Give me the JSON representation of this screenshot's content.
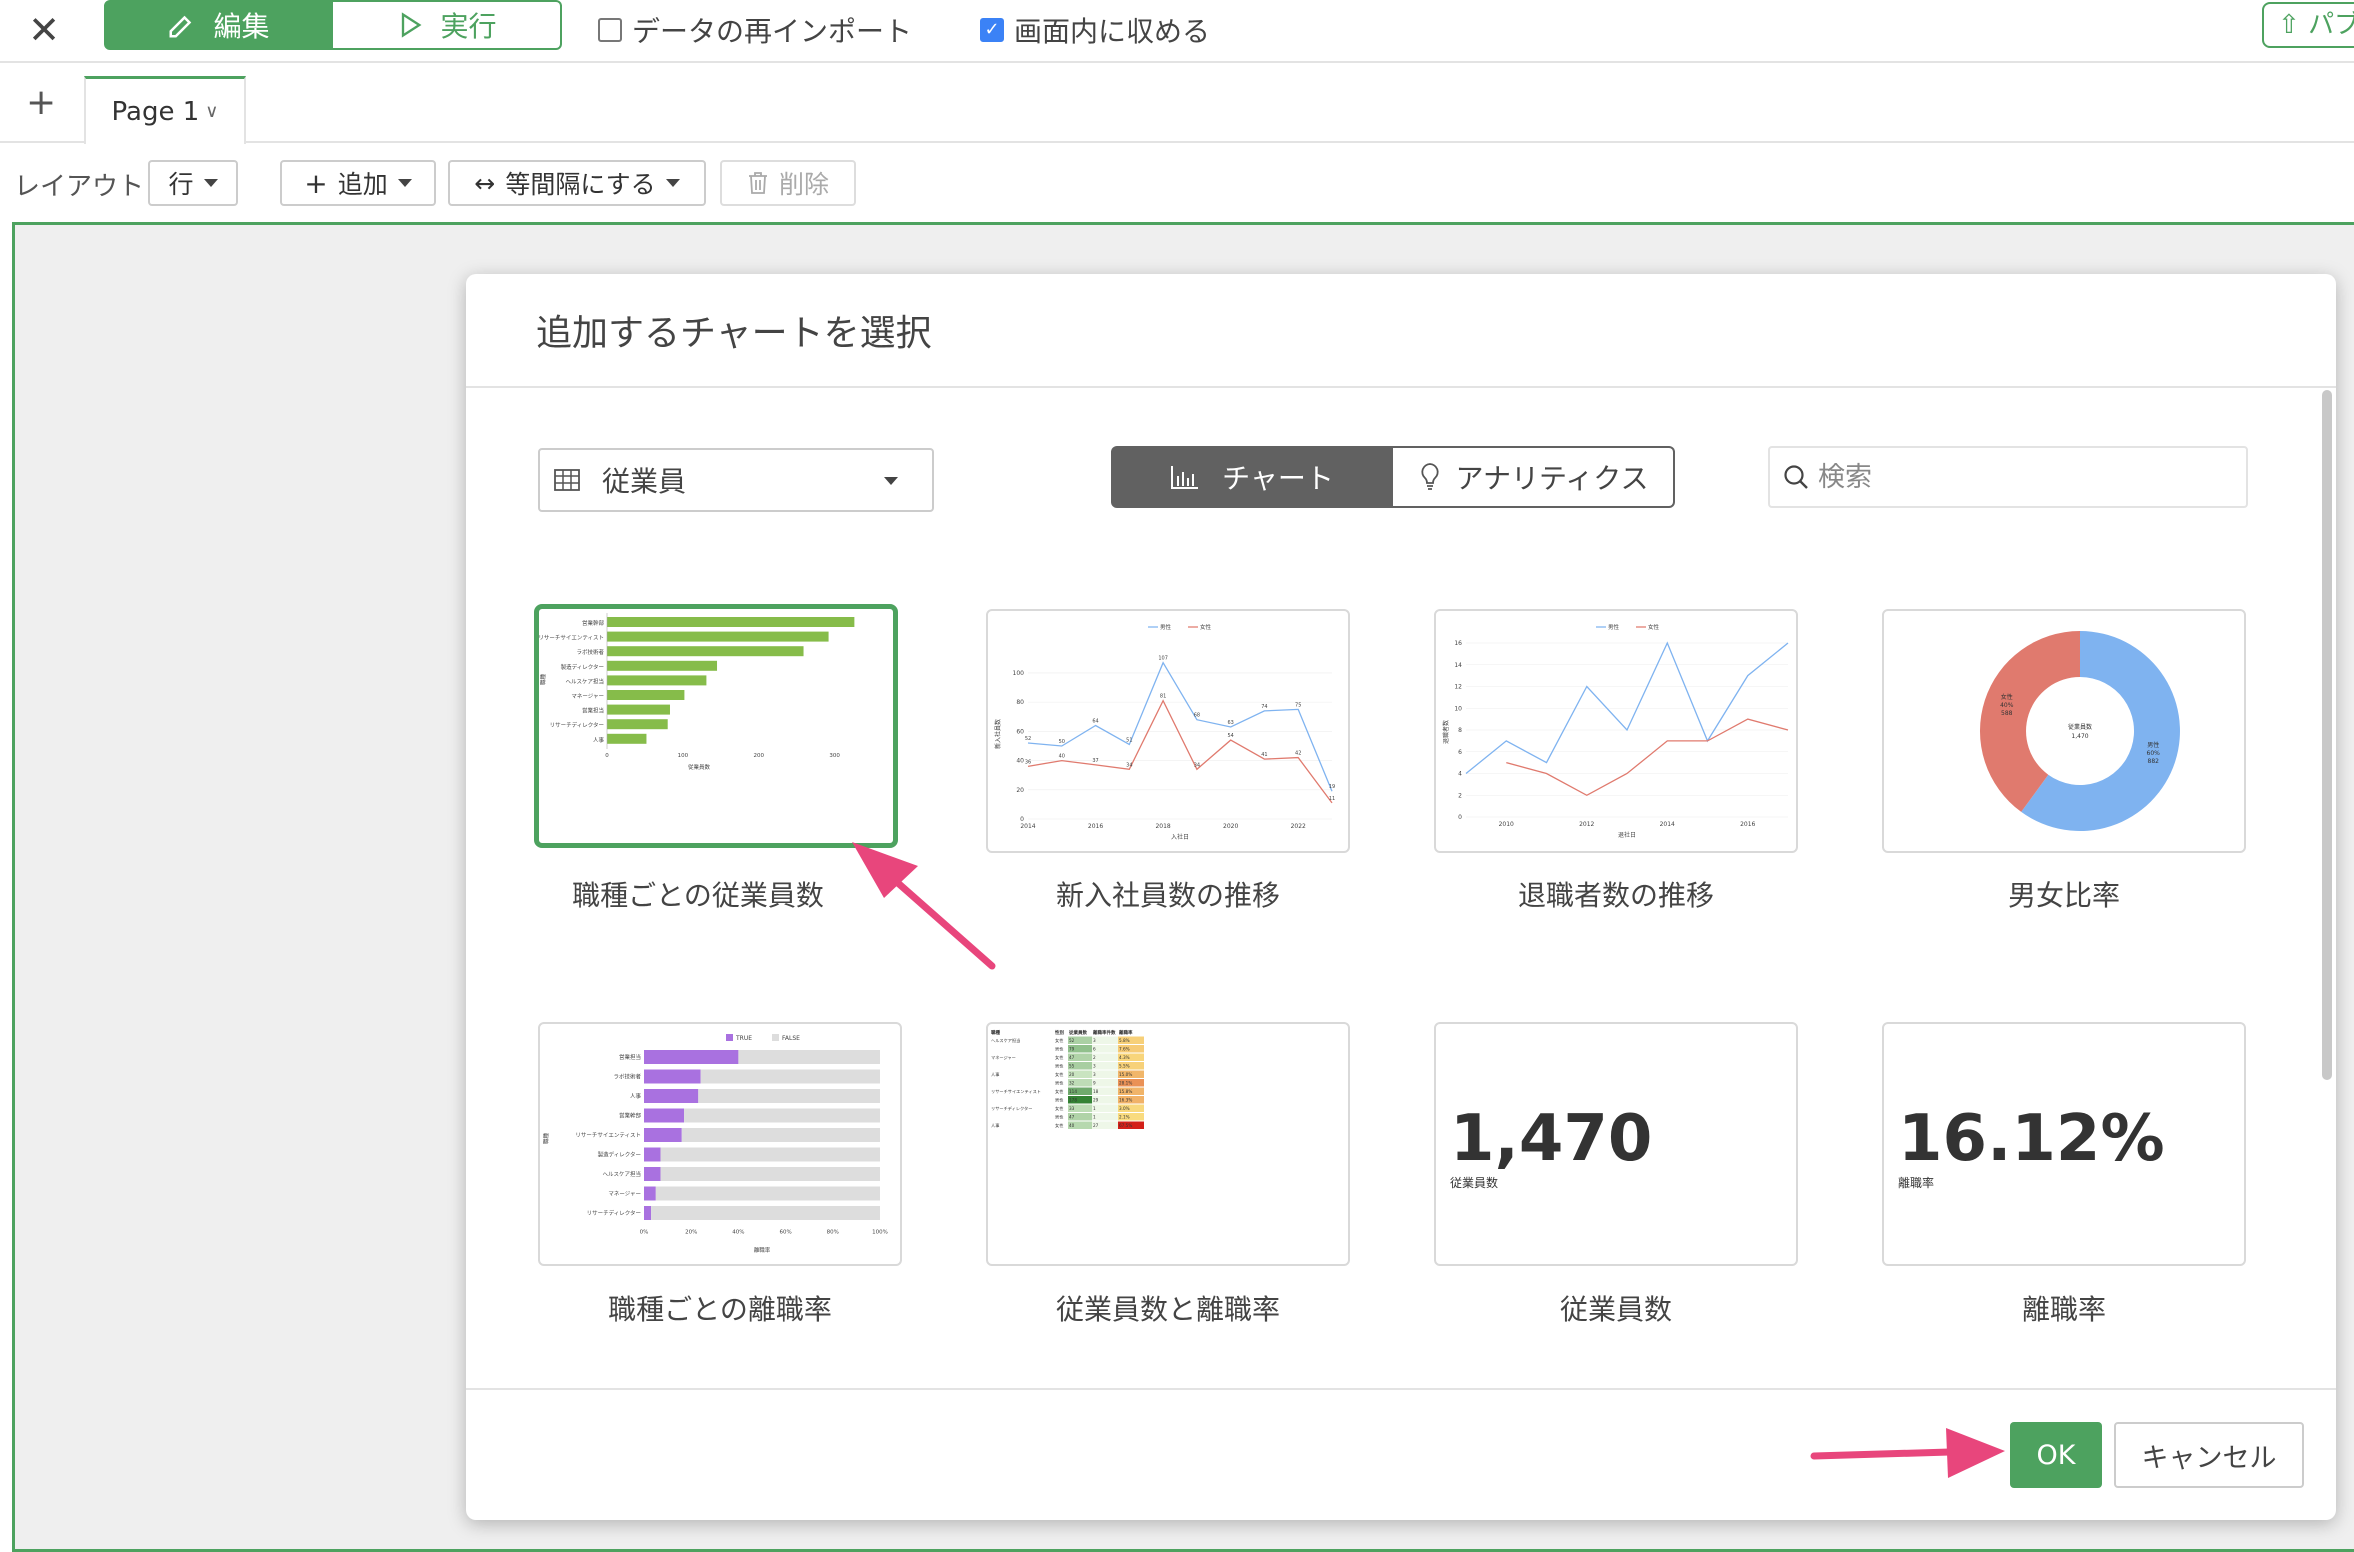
{
  "toolbar": {
    "edit_label": "編集",
    "run_label": "実行",
    "reimport_label": "データの再インポート",
    "reimport_checked": false,
    "fit_label": "画面内に収める",
    "fit_checked": true,
    "publish_label": "パブ"
  },
  "pages": {
    "tabs": [
      {
        "label": "Page 1"
      }
    ]
  },
  "layout_bar": {
    "label": "レイアウト",
    "row_label": "行",
    "add_label": "追加",
    "equal_spacing_label": "等間隔にする",
    "delete_label": "削除"
  },
  "modal": {
    "title": "追加するチャートを選択",
    "datasource": "従業員",
    "tabs": {
      "chart": "チャート",
      "analytics": "アナリティクス"
    },
    "search_placeholder": "検索",
    "cards": [
      {
        "label": "職種ごとの従業員数",
        "selected": true
      },
      {
        "label": "新入社員数の推移",
        "selected": false
      },
      {
        "label": "退職者数の推移",
        "selected": false
      },
      {
        "label": "男女比率",
        "selected": false
      },
      {
        "label": "職種ごとの離職率",
        "selected": false
      },
      {
        "label": "従業員数と離職率",
        "selected": false
      },
      {
        "label": "従業員数",
        "selected": false
      },
      {
        "label": "離職率",
        "selected": false
      }
    ],
    "kpis": {
      "employees": {
        "value": "1,470",
        "caption": "従業員数"
      },
      "attrition": {
        "value": "16.12%",
        "caption": "離職率"
      }
    },
    "ok_label": "OK",
    "cancel_label": "キャンセル"
  },
  "colors": {
    "accent": "#4da25f",
    "bar_green": "#86bc4a",
    "bar_purple": "#a971e0",
    "male_blue": "#7fb3f0",
    "female_red": "#e07a6e",
    "arrow": "#e8467c"
  },
  "chart_data": [
    {
      "type": "bar",
      "orientation": "horizontal",
      "categories": [
        "営業幹部",
        "リサーチサイエンティスト",
        "ラボ技術者",
        "製造ディレクター",
        "ヘルスケア担当",
        "マネージャー",
        "営業担当",
        "リサーチディレクター",
        "人事"
      ],
      "values": [
        326,
        292,
        259,
        145,
        131,
        102,
        83,
        80,
        52
      ],
      "xticks": [
        "0",
        "100",
        "200",
        "300"
      ],
      "xlabel": "従業員数",
      "ylabel": "職種",
      "xlim": [
        0,
        340
      ]
    },
    {
      "type": "line",
      "x": [
        "2014",
        "2015",
        "2016",
        "2017",
        "2018",
        "2019",
        "2020",
        "2021",
        "2022",
        "2023"
      ],
      "series": [
        {
          "name": "男性",
          "values": [
            52,
            50,
            64,
            51,
            107,
            68,
            63,
            74,
            75,
            19
          ]
        },
        {
          "name": "女性",
          "values": [
            36,
            40,
            37,
            34,
            81,
            34,
            54,
            41,
            42,
            11
          ]
        }
      ],
      "yticks": [
        "0",
        "20",
        "40",
        "60",
        "80",
        "100"
      ],
      "xticks": [
        "2014",
        "2016",
        "2018",
        "2020",
        "2022"
      ],
      "xlabel": "入社日",
      "ylabel": "新入社員数",
      "ylim": [
        0,
        115
      ]
    },
    {
      "type": "line",
      "x": [
        "2009",
        "2010",
        "2011",
        "2012",
        "2013",
        "2014",
        "2015",
        "2016",
        "2017"
      ],
      "series": [
        {
          "name": "男性",
          "values": [
            4,
            7,
            5,
            12,
            8,
            16,
            7,
            13,
            16
          ]
        },
        {
          "name": "女性",
          "values": [
            null,
            5,
            4,
            2,
            4,
            7,
            7,
            9,
            8
          ]
        }
      ],
      "yticks": [
        "0",
        "2",
        "4",
        "6",
        "8",
        "10",
        "12",
        "14",
        "16"
      ],
      "xticks": [
        "2010",
        "2012",
        "2014",
        "2016"
      ],
      "xlabel": "退社日",
      "ylabel": "退職者数",
      "ylim": [
        0,
        16
      ]
    },
    {
      "type": "pie",
      "donut": true,
      "slices": [
        {
          "name": "男性",
          "pct": "60%",
          "value": 882
        },
        {
          "name": "女性",
          "pct": "40%",
          "value": 588
        }
      ],
      "center_label": "従業員数",
      "center_value": "1,470"
    },
    {
      "type": "bar",
      "orientation": "horizontal",
      "stacked": true,
      "categories": [
        "営業担当",
        "ラボ技術者",
        "人事",
        "営業幹部",
        "リサーチサイエンティスト",
        "製造ディレクター",
        "ヘルスケア担当",
        "マネージャー",
        "リサーチディレクター"
      ],
      "series": [
        {
          "name": "TRUE",
          "values": [
            40,
            24,
            23,
            17,
            16,
            7,
            7,
            5,
            3
          ]
        },
        {
          "name": "FALSE",
          "values": [
            60,
            76,
            77,
            83,
            84,
            93,
            93,
            95,
            97
          ]
        }
      ],
      "xticks": [
        "0%",
        "20%",
        "40%",
        "60%",
        "80%",
        "100%"
      ],
      "xlabel": "離職率",
      "ylabel": "職種"
    },
    {
      "type": "table",
      "columns": [
        "職種",
        "性別",
        "従業員数",
        "離職率件数",
        "離職率"
      ],
      "rows": [
        [
          "ヘルスケア担当",
          "女性",
          "52",
          "3",
          "5.8%"
        ],
        [
          "",
          "男性",
          "79",
          "6",
          "7.6%"
        ],
        [
          "マネージャー",
          "女性",
          "47",
          "2",
          "4.3%"
        ],
        [
          "",
          "男性",
          "55",
          "3",
          "5.5%"
        ],
        [
          "人事",
          "女性",
          "20",
          "3",
          "15.0%"
        ],
        [
          "",
          "男性",
          "32",
          "9",
          "28.1%"
        ],
        [
          "リサーチサイエンティスト",
          "女性",
          "114",
          "18",
          "15.8%"
        ],
        [
          "",
          "男性",
          "178",
          "29",
          "16.3%"
        ],
        [
          "リサーチディレクター",
          "女性",
          "33",
          "1",
          "3.0%"
        ],
        [
          "",
          "男性",
          "47",
          "1",
          "2.1%"
        ],
        [
          "人事",
          "女性",
          "40",
          "27",
          "67.5%"
        ]
      ]
    }
  ]
}
